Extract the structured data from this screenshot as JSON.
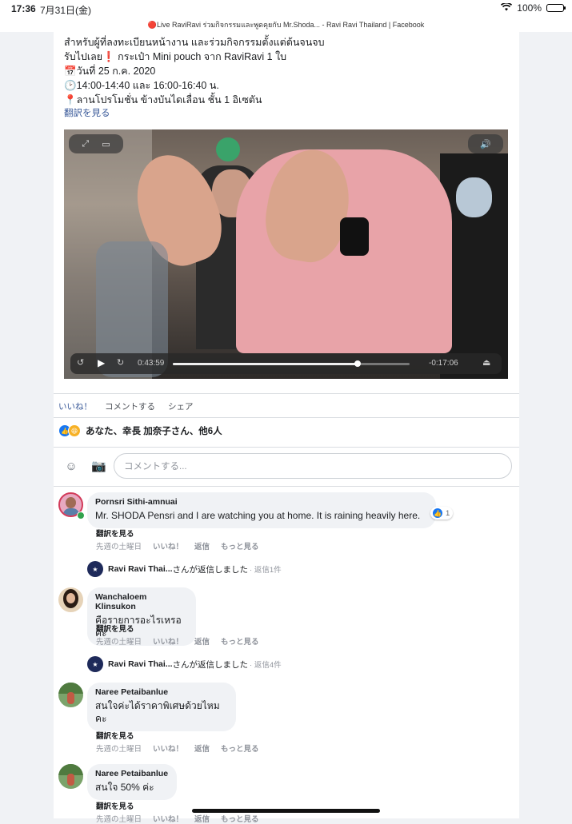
{
  "status_bar": {
    "time": "17:36",
    "date": "7月31日(金)",
    "battery": "100%",
    "tab_title": "🔴Live RaviRavi ร่วมกิจกรรมและพูดคุยกับ Mr.Shoda... - Ravi Ravi Thailand | Facebook"
  },
  "post": {
    "lines": [
      "สำหรับผู้ที่ลงทะเบียนหน้างาน และร่วมกิจกรรมตั้งแต่ต้นจนจบ",
      "รับไปเลย❗️ กระเป๋า Mini pouch จาก RaviRavi 1 ใบ",
      "📅วันที่ 25 ก.ค. 2020",
      "🕑14:00-14:40 และ 16:00-16:40 น.",
      "📍ลานโปรโมชั่น ข้างบันไดเลื่อน ชั้น 1 อิเซตัน"
    ],
    "see_translation": "翻訳を見る"
  },
  "video": {
    "elapsed": "0:43:59",
    "remaining": "-0:17:06",
    "progress": 0.78,
    "skip_seconds": "15"
  },
  "actions": {
    "like": "いいね！",
    "comment": "コメントする",
    "share": "シェア"
  },
  "reactions_text": "あなた、幸長 加奈子さん、他6人",
  "composer": {
    "placeholder": "コメントする..."
  },
  "comments": [
    {
      "name": "Pornsri Sithi-amnuai",
      "text": "Mr. SHODA Pensri and I are watching you at home. It is raining heavily here.",
      "likes": "1",
      "translate": "翻訳を見る",
      "time": "先週の土曜日",
      "like": "いいね！",
      "reply": "返信",
      "more": "もっと見る"
    },
    {
      "name": "Wanchaloem Klinsukon",
      "text": "คือรายการอะไรเหรอคะ",
      "translate": "翻訳を見る",
      "time": "先週の土曜日",
      "like": "いいね！",
      "reply": "返信",
      "more": "もっと見る"
    },
    {
      "name": "Naree Petaibanlue",
      "text_line1": "สนใจค่ะได้ราคาพิเศษด้วยไหม",
      "text_line2": "คะ",
      "translate": "翻訳を見る",
      "time": "先週の土曜日",
      "like": "いいね！",
      "reply": "返信",
      "more": "もっと見る"
    },
    {
      "name": "Naree Petaibanlue",
      "text": "สนใจ 50% ค่ะ",
      "translate": "翻訳を見る",
      "time": "先週の土曜日",
      "like": "いいね！",
      "reply": "返信",
      "more": "もっと見る"
    }
  ],
  "replies": [
    {
      "who": "Ravi Ravi Thai...",
      "suffix": "さんが返信しました",
      "count": "· 返信1件"
    },
    {
      "who": "Ravi Ravi Thai...",
      "suffix": "さんが返信しました",
      "count": "· 返信4件"
    }
  ],
  "colors": {
    "link": "#385898",
    "like_blue": "#1877f2",
    "bubble": "#f0f2f5"
  }
}
